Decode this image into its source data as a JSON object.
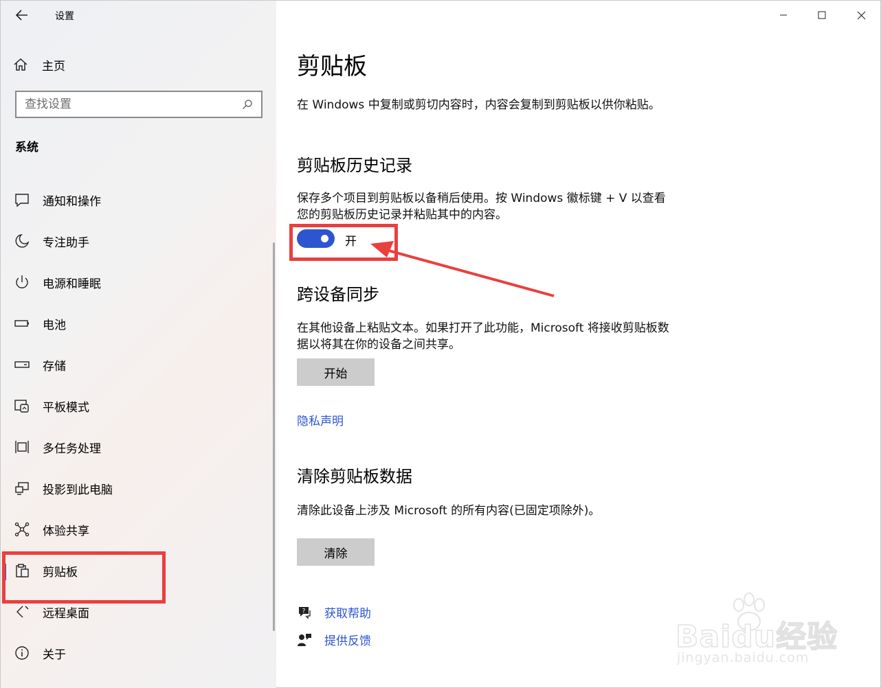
{
  "app": {
    "title": "设置",
    "brand_color": "#2d55d0",
    "highlight_color": "#ea3f3f"
  },
  "sidebar": {
    "home_label": "主页",
    "search_placeholder": "查找设置",
    "section_title": "系统",
    "items": [
      {
        "label": "通知和操作",
        "icon": "notification-icon"
      },
      {
        "label": "专注助手",
        "icon": "moon-icon"
      },
      {
        "label": "电源和睡眠",
        "icon": "power-icon"
      },
      {
        "label": "电池",
        "icon": "battery-icon"
      },
      {
        "label": "存储",
        "icon": "storage-icon"
      },
      {
        "label": "平板模式",
        "icon": "tablet-mode-icon"
      },
      {
        "label": "多任务处理",
        "icon": "multitasking-icon"
      },
      {
        "label": "投影到此电脑",
        "icon": "project-icon"
      },
      {
        "label": "体验共享",
        "icon": "share-icon"
      },
      {
        "label": "剪贴板",
        "icon": "clipboard-icon",
        "active": true
      },
      {
        "label": "远程桌面",
        "icon": "remote-desktop-icon"
      },
      {
        "label": "关于",
        "icon": "info-icon"
      }
    ]
  },
  "main": {
    "title": "剪贴板",
    "intro": "在 Windows 中复制或剪切内容时，内容会复制到剪贴板以供你粘贴。",
    "history": {
      "heading": "剪贴板历史记录",
      "desc_line1": "保存多个项目到剪贴板以备稍后使用。按 Windows 徽标键 + V 以查看",
      "desc_line2": "您的剪贴板历史记录并粘贴其中的内容。",
      "toggle_state": "开",
      "toggle_on": true
    },
    "sync": {
      "heading": "跨设备同步",
      "desc_line1": "在其他设备上粘贴文本。如果打开了此功能，Microsoft 将接收剪贴板数",
      "desc_line2": "据以将其在你的设备之间共享。",
      "button": "开始",
      "privacy_link": "隐私声明"
    },
    "clear": {
      "heading": "清除剪贴板数据",
      "desc": "清除此设备上涉及 Microsoft 的所有内容(已固定项除外)。",
      "button": "清除"
    },
    "help": {
      "get_help": "获取帮助",
      "feedback": "提供反馈"
    }
  },
  "watermark": {
    "big": "Baidu经验",
    "small": "jingyan.baidu.com"
  }
}
